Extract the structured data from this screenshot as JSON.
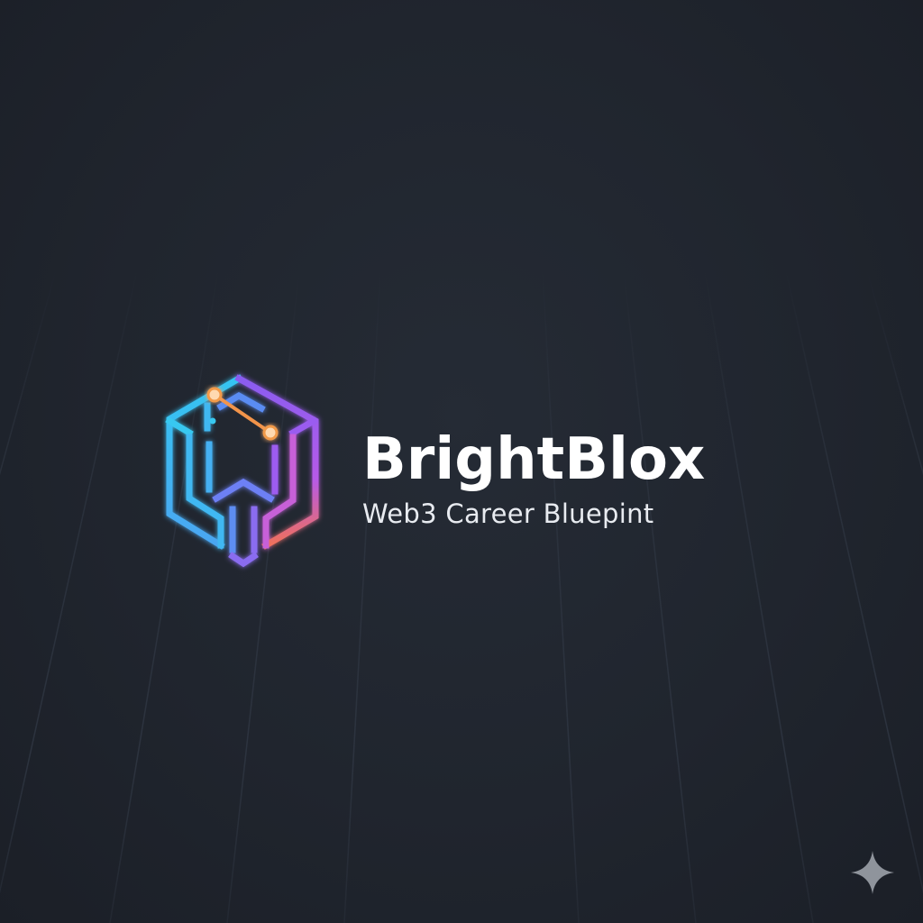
{
  "brand": {
    "name": "BrightBlox",
    "tagline": "Web3 Career Bluepint"
  },
  "logo": {
    "icon": "hexagon-cube-circuit-logo-icon",
    "gradient_colors": [
      "#38c8f0",
      "#6a7cf5",
      "#a35af0",
      "#f0705a"
    ],
    "node_color": "#f29a4a"
  },
  "decoration": {
    "corner_icon": "sparkle-icon",
    "corner_icon_color": "#8f949c"
  },
  "colors": {
    "background": "#20252e",
    "grid_line": "#2c333e",
    "text_primary": "#ffffff",
    "text_secondary": "#e8ebf0"
  }
}
